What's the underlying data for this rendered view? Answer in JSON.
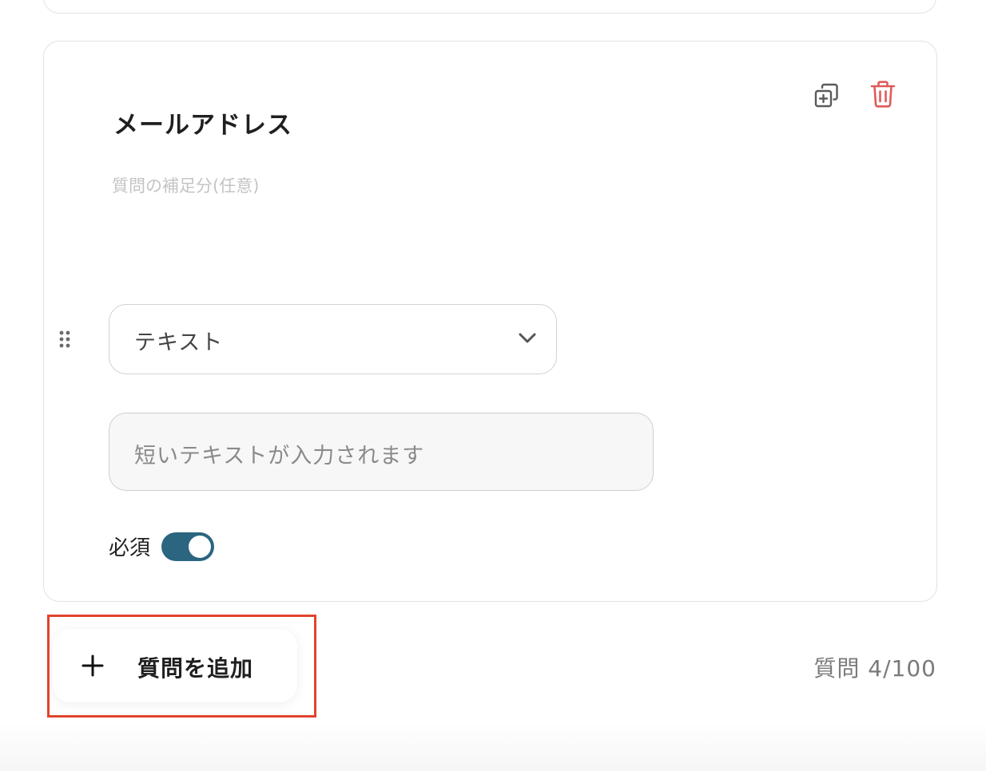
{
  "question": {
    "title": "メールアドレス",
    "description_placeholder": "質問の補足分(任意)",
    "type_selected": "テキスト",
    "answer_preview": "短いテキストが入力されます",
    "required_label": "必須",
    "required_on": true
  },
  "actions": {
    "add_question_label": "質問を追加"
  },
  "footer": {
    "question_count": "質問 4/100"
  },
  "icons": {
    "copy": "copy-plus-icon",
    "delete": "trash-icon",
    "drag": "drag-dots-icon",
    "chevron": "chevron-down-icon",
    "plus": "plus-icon"
  },
  "colors": {
    "accent": "#2b6580",
    "danger": "#e05a5a",
    "highlight": "#e0442c"
  }
}
